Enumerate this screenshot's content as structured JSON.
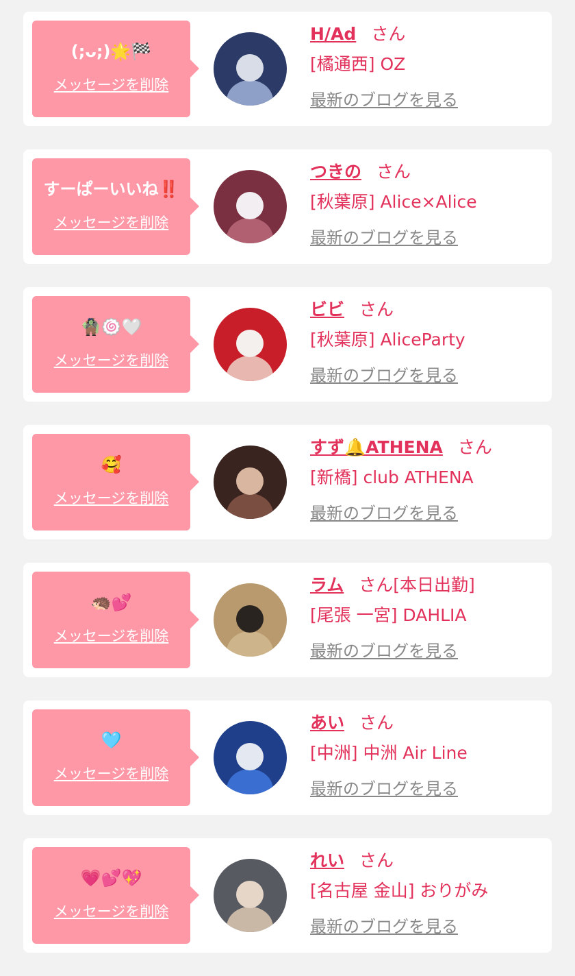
{
  "common": {
    "delete_label": "メッセージを削除",
    "honorific": "さん",
    "blog_label": "最新のブログを見る"
  },
  "colors": {
    "background": "#f2f2f2",
    "card": "#ffffff",
    "bubble": "#fe98a7",
    "accent": "#e2315a",
    "link_gray": "#888888"
  },
  "entries": [
    {
      "message": "(;ᴗ;)🌟🏁",
      "name": "H/Ad",
      "status": "",
      "shop": "[橘通西] OZ",
      "avatar_icon": "avatar-photo-white-suit",
      "avatar_colors": [
        "#2b3a66",
        "#d9dde8",
        "#8fa0c8"
      ]
    },
    {
      "message": "すーぱーいいね‼️",
      "name": "つきの",
      "status": "",
      "shop": "[秋葉原] Alice×Alice",
      "avatar_icon": "avatar-photo-white-dress",
      "avatar_colors": [
        "#7a3040",
        "#f2eef2",
        "#b06070"
      ]
    },
    {
      "message": "🧌🍥🤍",
      "name": "ビビ",
      "status": "",
      "shop": "[秋葉原] AliceParty",
      "avatar_icon": "avatar-photo-red-dress",
      "avatar_colors": [
        "#c81e2a",
        "#f4f0ee",
        "#e8b8b0"
      ]
    },
    {
      "message": "🥰",
      "name": "すず🔔ATHENA",
      "status": "",
      "shop": "[新橋] club ATHENA",
      "avatar_icon": "avatar-photo-portrait",
      "avatar_colors": [
        "#3a2420",
        "#d9b6a0",
        "#7a4e40"
      ]
    },
    {
      "message": "🦔💕",
      "name": "ラム",
      "status": "[本日出勤]",
      "shop": "[尾張 一宮] DAHLIA",
      "avatar_icon": "avatar-photo-hair-closeup",
      "avatar_colors": [
        "#b89a6e",
        "#2a2420",
        "#cdb48a"
      ]
    },
    {
      "message": "🩵",
      "name": "あい",
      "status": "",
      "shop": "[中洲] 中洲 Air Line",
      "avatar_icon": "avatar-photo-airport-board",
      "avatar_colors": [
        "#1f3f8a",
        "#e4e8f0",
        "#3a6ed0"
      ]
    },
    {
      "message": "💗💕💖",
      "name": "れい",
      "status": "",
      "shop": "[名古屋 金山] おりがみ",
      "avatar_icon": "avatar-photo-blonde",
      "avatar_colors": [
        "#585a62",
        "#e6d6c8",
        "#c9b8a6"
      ]
    }
  ]
}
